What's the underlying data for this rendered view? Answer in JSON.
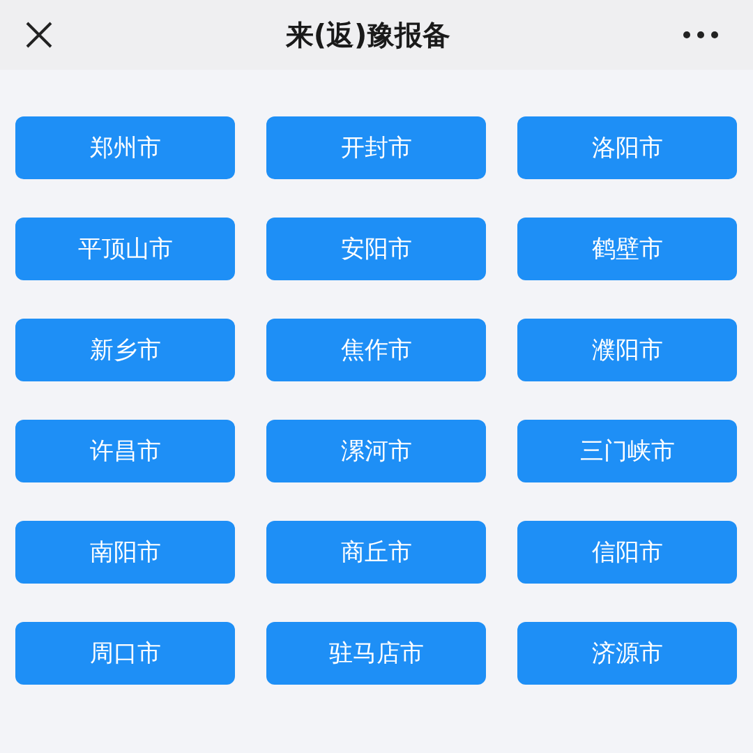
{
  "header": {
    "title": "来(返)豫报备"
  },
  "cities": [
    "郑州市",
    "开封市",
    "洛阳市",
    "平顶山市",
    "安阳市",
    "鹤壁市",
    "新乡市",
    "焦作市",
    "濮阳市",
    "许昌市",
    "漯河市",
    "三门峡市",
    "南阳市",
    "商丘市",
    "信阳市",
    "周口市",
    "驻马店市",
    "济源市"
  ]
}
